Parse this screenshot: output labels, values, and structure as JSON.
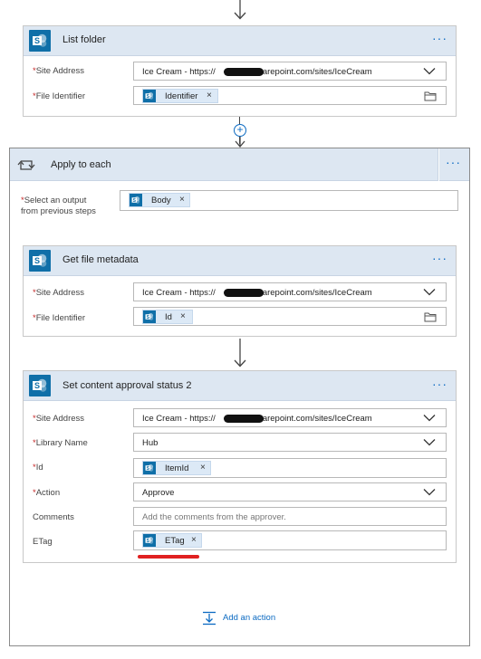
{
  "list_folder": {
    "title": "List folder",
    "more": "···",
    "site_address": {
      "required_mark": "*",
      "label": "Site Address",
      "value_prefix": "Ice Cream - https://",
      "value_suffix": "sharepoint.com/sites/IceCream"
    },
    "file_identifier": {
      "required_mark": "*",
      "label": "File Identifier",
      "token": "Identifier",
      "remove": "×"
    }
  },
  "connector": {
    "add": "+"
  },
  "apply_to_each": {
    "title": "Apply to each",
    "more": "···",
    "select_output": {
      "required_mark": "*",
      "label_line1": "Select an output",
      "label_line2": "from previous steps",
      "token": "Body",
      "remove": "×"
    }
  },
  "get_file_metadata": {
    "title": "Get file metadata",
    "more": "···",
    "site_address": {
      "required_mark": "*",
      "label": "Site Address",
      "value_prefix": "Ice Cream - https://",
      "value_suffix": "sharepoint.com/sites/IceCream"
    },
    "file_identifier": {
      "required_mark": "*",
      "label": "File Identifier",
      "token": "Id",
      "remove": "×"
    }
  },
  "set_content_approval": {
    "title": "Set content approval status 2",
    "more": "···",
    "site_address": {
      "required_mark": "*",
      "label": "Site Address",
      "value_prefix": "Ice Cream - https://",
      "value_suffix": "sharepoint.com/sites/IceCream"
    },
    "library_name": {
      "required_mark": "*",
      "label": "Library Name",
      "value": "Hub"
    },
    "id": {
      "required_mark": "*",
      "label": "Id",
      "token": "ItemId",
      "remove": "×"
    },
    "action": {
      "required_mark": "*",
      "label": "Action",
      "value": "Approve"
    },
    "comments": {
      "label": "Comments",
      "placeholder": "Add the comments from the approver."
    },
    "etag": {
      "label": "ETag",
      "token": "ETag",
      "remove": "×"
    }
  },
  "add_action": {
    "label": "Add an action"
  },
  "colors": {
    "header_bg": "#dde7f2",
    "sharepoint": "#0f6fa8",
    "accent": "#0b6ac2",
    "required": "#c62828",
    "highlight_underline": "#e02020"
  }
}
